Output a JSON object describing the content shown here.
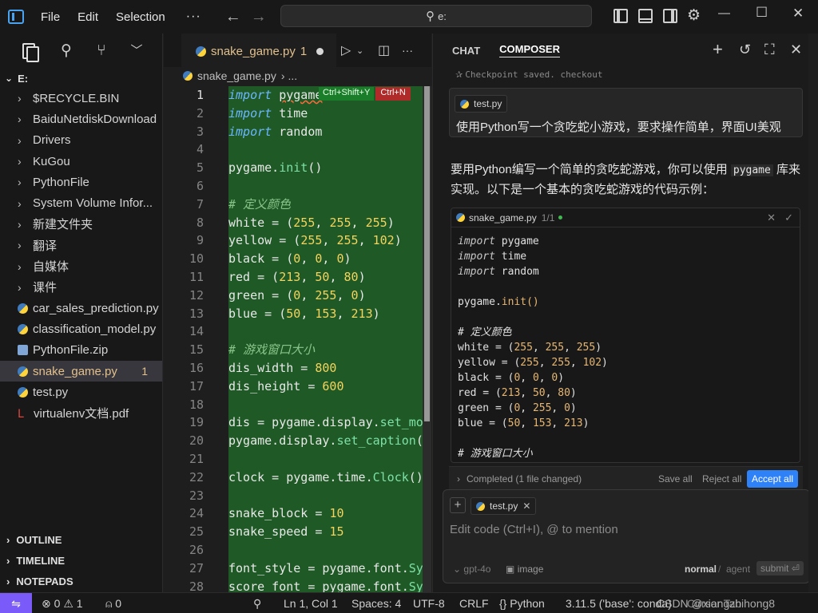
{
  "menu": {
    "file": "File",
    "edit": "Edit",
    "selection": "Selection",
    "more": "···"
  },
  "search": {
    "value": "e:"
  },
  "sidebar": {
    "root": "E:",
    "items": [
      {
        "label": "$RECYCLE.BIN",
        "type": "folder"
      },
      {
        "label": "BaiduNetdiskDownload",
        "type": "folder"
      },
      {
        "label": "Drivers",
        "type": "folder"
      },
      {
        "label": "KuGou",
        "type": "folder"
      },
      {
        "label": "PythonFile",
        "type": "folder"
      },
      {
        "label": "System Volume Infor...",
        "type": "folder"
      },
      {
        "label": "新建文件夹",
        "type": "folder"
      },
      {
        "label": "翻译",
        "type": "folder"
      },
      {
        "label": "自媒体",
        "type": "folder"
      },
      {
        "label": "课件",
        "type": "folder"
      },
      {
        "label": "car_sales_prediction.py",
        "type": "py"
      },
      {
        "label": "classification_model.py",
        "type": "py"
      },
      {
        "label": "PythonFile.zip",
        "type": "zip"
      },
      {
        "label": "snake_game.py",
        "type": "py",
        "badge": "1",
        "selected": true
      },
      {
        "label": "test.py",
        "type": "py"
      },
      {
        "label": "virtualenv文档.pdf",
        "type": "pdf"
      }
    ],
    "sections": {
      "outline": "OUTLINE",
      "timeline": "TIMELINE",
      "notepads": "NOTEPADS"
    }
  },
  "editor": {
    "tab": {
      "label": "snake_game.py",
      "count": "1"
    },
    "breadcrumb": {
      "file": "snake_game.py",
      "more": "..."
    },
    "hint": {
      "accept": "Ctrl+Shift+Y",
      "reject": "Ctrl+N"
    },
    "line_numbers": [
      "1",
      "2",
      "3",
      "4",
      "5",
      "6",
      "7",
      "8",
      "9",
      "10",
      "11",
      "12",
      "13",
      "14",
      "15",
      "16",
      "17",
      "18",
      "19",
      "20",
      "21",
      "22",
      "23",
      "24",
      "25",
      "26",
      "27",
      "28"
    ],
    "code": {
      "l1_kw": "import",
      "l1_mod": "pygame",
      "l2_kw": "import",
      "l2_mod": " time",
      "l3_kw": "import",
      "l3_mod": " random",
      "l5_a": "pygame.",
      "l5_fn": "init",
      "l5_b": "()",
      "l7": "# 定义颜色",
      "l8_a": "white = (",
      "l8_n1": "255",
      "l8_s1": ", ",
      "l8_n2": "255",
      "l8_s2": ", ",
      "l8_n3": "255",
      "l8_b": ")",
      "l9_a": "yellow = (",
      "l9_n1": "255",
      "l9_s1": ", ",
      "l9_n2": "255",
      "l9_s2": ", ",
      "l9_n3": "102",
      "l9_b": ")",
      "l10_a": "black = (",
      "l10_n1": "0",
      "l10_s1": ", ",
      "l10_n2": "0",
      "l10_s2": ", ",
      "l10_n3": "0",
      "l10_b": ")",
      "l11_a": "red = (",
      "l11_n1": "213",
      "l11_s1": ", ",
      "l11_n2": "50",
      "l11_s2": ", ",
      "l11_n3": "80",
      "l11_b": ")",
      "l12_a": "green = (",
      "l12_n1": "0",
      "l12_s1": ", ",
      "l12_n2": "255",
      "l12_s2": ", ",
      "l12_n3": "0",
      "l12_b": ")",
      "l13_a": "blue = (",
      "l13_n1": "50",
      "l13_s1": ", ",
      "l13_n2": "153",
      "l13_s2": ", ",
      "l13_n3": "213",
      "l13_b": ")",
      "l15": "# 游戏窗口大小",
      "l16_a": "dis_width = ",
      "l16_n": "800",
      "l17_a": "dis_height = ",
      "l17_n": "600",
      "l19_a": "dis = pygame.display.",
      "l19_fn": "set_mode",
      "l20_a": "pygame.display.",
      "l20_fn": "set_caption",
      "l20_b": "(",
      "l22_a": "clock = pygame.time.",
      "l22_fn": "Clock",
      "l22_b": "()",
      "l24_a": "snake_block = ",
      "l24_n": "10",
      "l25_a": "snake_speed = ",
      "l25_n": "15",
      "l27_a": "font_style = pygame.font.",
      "l27_fn": "SysFont",
      "l28_a": "score_font = pygame.font.",
      "l28_fn": "SysFont"
    }
  },
  "panel": {
    "tabs": {
      "chat": "CHAT",
      "composer": "COMPOSER"
    },
    "checkpoint": "Checkpoint saved. checkout",
    "user_file": "test.py",
    "user_text": "使用Python写一个贪吃蛇小游戏，要求操作简单，界面UI美观",
    "assistant_text_1": "要用Python编写一个简单的贪吃蛇游戏，你可以使用",
    "assistant_code": "pygame",
    "assistant_text_2": "库来实现。以下是一个基本的贪吃蛇游戏的代码示例：",
    "card": {
      "file": "snake_game.py",
      "count": "1/1"
    },
    "card_code": {
      "c1_kw": "import",
      "c1_m": " pygame",
      "c2_kw": "import",
      "c2_m": " time",
      "c3_kw": "import",
      "c3_m": " random",
      "c5_a": "pygame.",
      "c5_fn": "init",
      "c5_b": "()",
      "c7": "# 定义颜色",
      "c8_a": "white = (",
      "c8_n1": "255",
      "c8_s1": ", ",
      "c8_n2": "255",
      "c8_s2": ", ",
      "c8_n3": "255",
      "c8_b": ")",
      "c9_a": "yellow = (",
      "c9_n1": "255",
      "c9_s1": ", ",
      "c9_n2": "255",
      "c9_s2": ", ",
      "c9_n3": "102",
      "c9_b": ")",
      "c10_a": "black = (",
      "c10_n1": "0",
      "c10_s1": ", ",
      "c10_n2": "0",
      "c10_s2": ", ",
      "c10_n3": "0",
      "c10_b": ")",
      "c11_a": "red = (",
      "c11_n1": "213",
      "c11_s1": ", ",
      "c11_n2": "50",
      "c11_s2": ", ",
      "c11_n3": "80",
      "c11_b": ")",
      "c12_a": "green = (",
      "c12_n1": "0",
      "c12_s1": ", ",
      "c12_n2": "255",
      "c12_s2": ", ",
      "c12_n3": "0",
      "c12_b": ")",
      "c13_a": "blue = (",
      "c13_n1": "50",
      "c13_s1": ", ",
      "c13_n2": "153",
      "c13_s2": ", ",
      "c13_n3": "213",
      "c13_b": ")",
      "c15": "# 游戏窗口大小"
    },
    "completed": "Completed (1 file changed)",
    "save_all": "Save all",
    "reject_all": "Reject all",
    "accept_all": "Accept all",
    "ctx_file": "test.py",
    "placeholder": "Edit code (Ctrl+I), @ to mention",
    "model": "gpt-4o",
    "image": "image",
    "mode_normal": "normal",
    "mode_sep": "/",
    "mode_agent": "agent",
    "submit": "submit"
  },
  "status": {
    "errors": "0",
    "warnings": "1",
    "ports": "0",
    "position": "Ln 1, Col 1",
    "spaces": "Spaces: 4",
    "encoding": "UTF-8",
    "eol": "CRLF",
    "language": "Python",
    "interpreter": "3.11.5 ('base': conda)",
    "cursor_tab": "Cursor Tab",
    "watermark": "CSDN @xiangzhihong8"
  }
}
